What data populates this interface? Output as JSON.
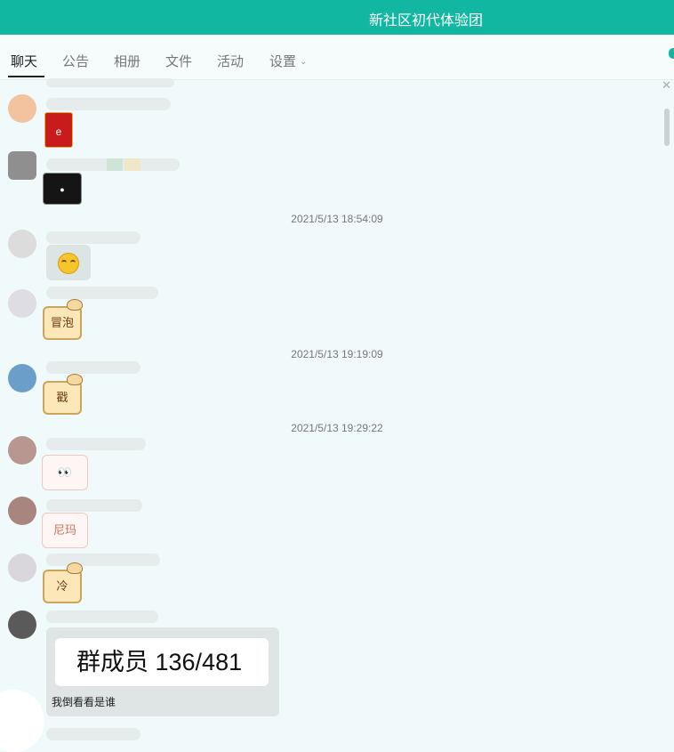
{
  "window": {
    "title": "新社区初代体验团"
  },
  "tabs": [
    {
      "label": "聊天",
      "active": true
    },
    {
      "label": "公告"
    },
    {
      "label": "相册"
    },
    {
      "label": "文件"
    },
    {
      "label": "活动"
    },
    {
      "label": "设置"
    }
  ],
  "timestamps": [
    "2021/5/13 18:54:09",
    "2021/5/13 19:19:09",
    "2021/5/13 19:29:22"
  ],
  "stickers": {
    "red_envelope": "e",
    "dark_box": "●",
    "bubble_label": "冒泡",
    "poke_label": "戳",
    "nima_label": "尼玛",
    "cold_label": "冷"
  },
  "reply": {
    "quote": "群成员 136/481",
    "text": "我倒看看是谁"
  },
  "colors": {
    "accent": "#12b7a1",
    "chat_bg": "#f1fafa"
  }
}
